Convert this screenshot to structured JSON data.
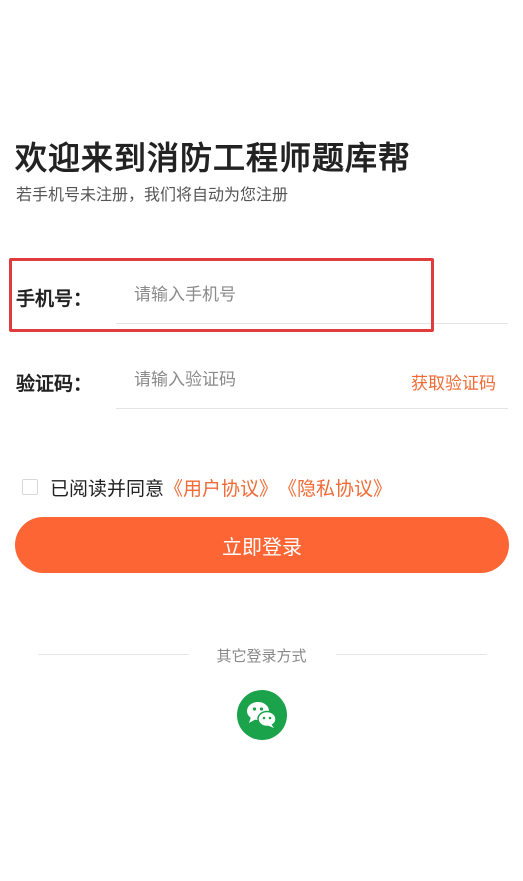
{
  "header": {
    "title": "欢迎来到消防工程师题库帮",
    "subtitle": "若手机号未注册，我们将自动为您注册"
  },
  "phone": {
    "label": "手机号：",
    "placeholder": "请输入手机号",
    "value": ""
  },
  "code": {
    "label": "验证码：",
    "placeholder": "请输入验证码",
    "value": "",
    "get_code_label": "获取验证码"
  },
  "agreement": {
    "checked": false,
    "prefix": "已阅读并同意",
    "user_agreement": "《用户协议》",
    "privacy_agreement": "《隐私协议》"
  },
  "login_button": {
    "label": "立即登录"
  },
  "other_login": {
    "label": "其它登录方式",
    "methods": [
      {
        "icon": "wechat-icon"
      }
    ]
  },
  "colors": {
    "accent": "#fe6534",
    "link": "#f06a35",
    "highlight": "#e03c3c",
    "wechat": "#1aa34a"
  }
}
